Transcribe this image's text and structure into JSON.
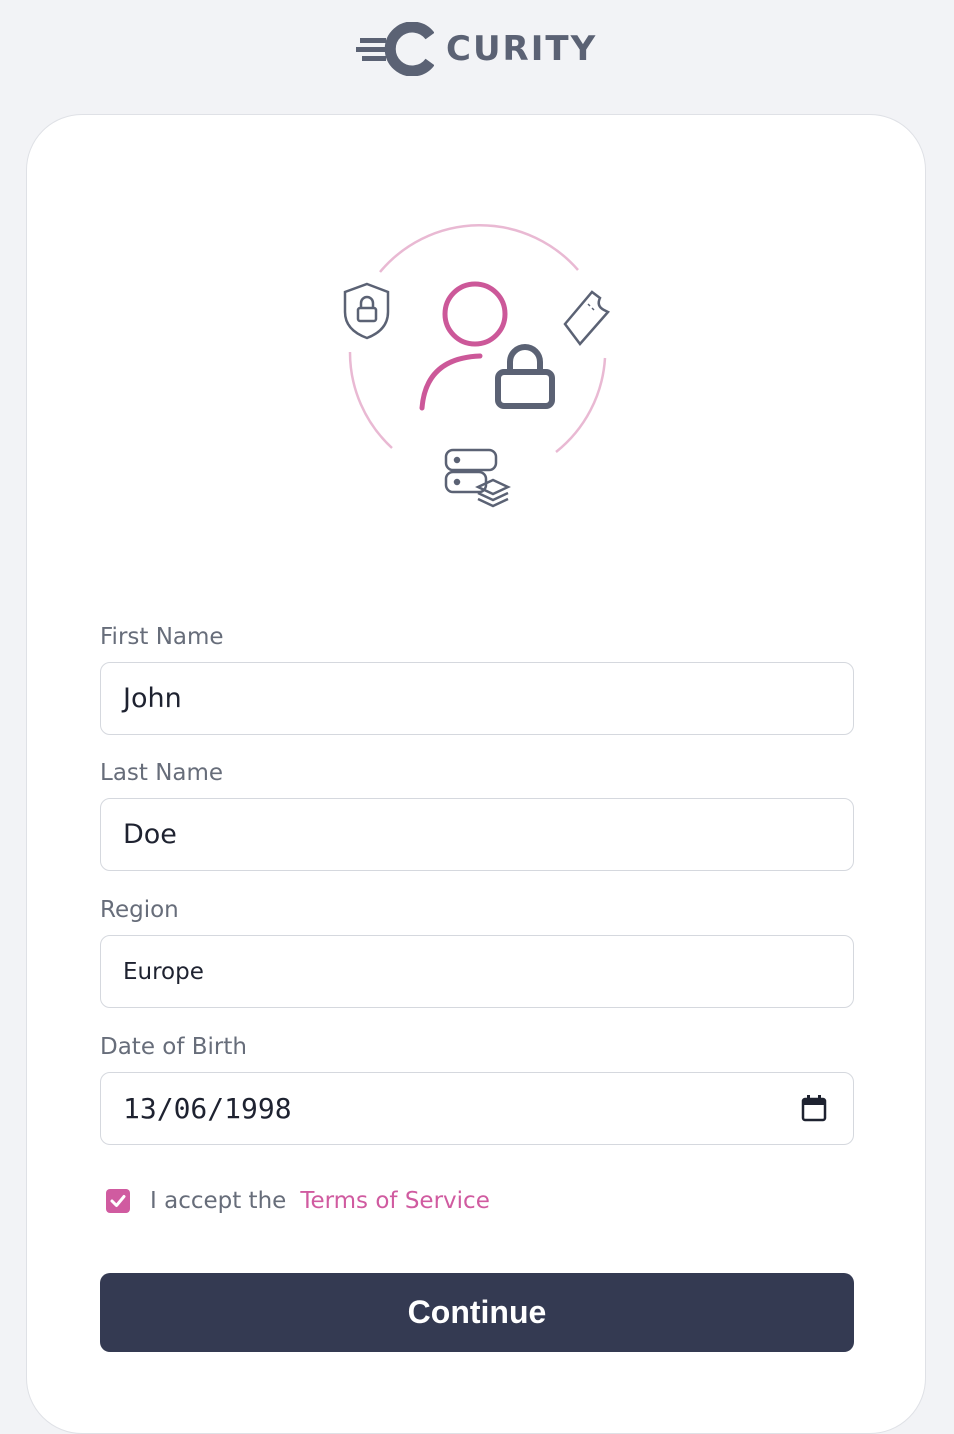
{
  "brand": {
    "name": "CURITY",
    "color": "#5b6274",
    "accent": "#d05ba0"
  },
  "illustration": {
    "icons": [
      "shield-lock-icon",
      "user-lock-icon",
      "ticket-icon",
      "server-stack-icon"
    ]
  },
  "form": {
    "first_name": {
      "label": "First Name",
      "value": "John"
    },
    "last_name": {
      "label": "Last Name",
      "value": "Doe"
    },
    "region": {
      "label": "Region",
      "value": "Europe"
    },
    "dob": {
      "label": "Date of Birth",
      "value": "13/06/1998",
      "icon": "calendar-icon"
    },
    "terms": {
      "prefix": "I accept the",
      "link": "Terms of Service",
      "checked": true
    },
    "submit_label": "Continue"
  }
}
